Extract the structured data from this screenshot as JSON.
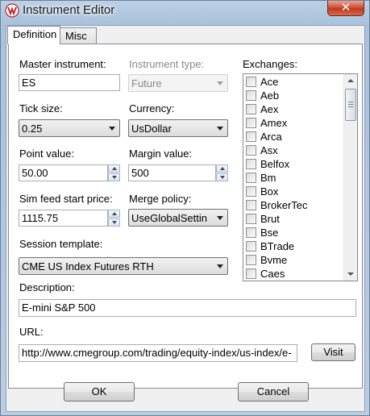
{
  "window": {
    "title": "Instrument Editor",
    "close_glyph": "✕"
  },
  "tabs": [
    {
      "label": "Definition",
      "active": true
    },
    {
      "label": "Misc",
      "active": false
    }
  ],
  "form": {
    "master_instrument": {
      "label": "Master instrument:",
      "value": "ES"
    },
    "instrument_type": {
      "label": "Instrument type:",
      "value": "Future",
      "disabled": true
    },
    "tick_size": {
      "label": "Tick size:",
      "value": "0.25"
    },
    "currency": {
      "label": "Currency:",
      "value": "UsDollar"
    },
    "point_value": {
      "label": "Point value:",
      "value": "50.00"
    },
    "margin_value": {
      "label": "Margin value:",
      "value": "500"
    },
    "sim_feed_start_price": {
      "label": "Sim feed start price:",
      "value": "1115.75"
    },
    "merge_policy": {
      "label": "Merge policy:",
      "value": "UseGlobalSettin"
    },
    "session_template": {
      "label": "Session template:",
      "value": "CME US Index Futures RTH"
    },
    "description": {
      "label": "Description:",
      "value": "E-mini S&P 500"
    },
    "url": {
      "label": "URL:",
      "value": "http://www.cmegroup.com/trading/equity-index/us-index/e-"
    }
  },
  "exchanges": {
    "label": "Exchanges:",
    "items": [
      "Ace",
      "Aeb",
      "Aex",
      "Amex",
      "Arca",
      "Asx",
      "Belfox",
      "Bm",
      "Box",
      "BrokerTec",
      "Brut",
      "Bse",
      "BTrade",
      "Bvme",
      "Caes"
    ]
  },
  "buttons": {
    "visit": "Visit",
    "ok": "OK",
    "cancel": "Cancel"
  },
  "colors": {
    "close_button": "#c8452a",
    "window_frame": "#b4c9e2"
  }
}
